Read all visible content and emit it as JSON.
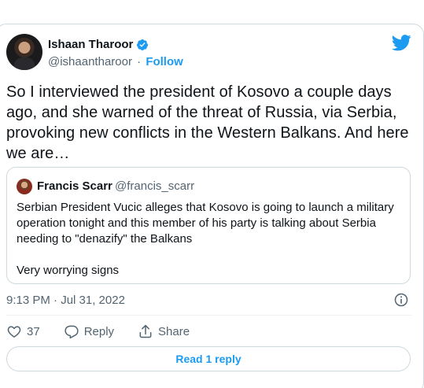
{
  "author": {
    "name": "Ishaan Tharoor",
    "handle": "@ishaantharoor",
    "separator": "·",
    "follow_label": "Follow"
  },
  "tweet": {
    "text": "So I interviewed the president of Kosovo a couple days ago, and she warned of the threat of Russia, via Serbia, provoking new conflicts in the Western Balkans. And here we are…",
    "timestamp": "9:13 PM · Jul 31, 2022"
  },
  "quoted": {
    "name": "Francis Scarr",
    "handle": "@francis_scarr",
    "text_1": "Serbian President Vucic alleges that Kosovo is going to launch a military operation tonight and this member of his party is talking about Serbia needing to \"denazify\" the Balkans",
    "text_2": "Very worrying signs"
  },
  "actions": {
    "like_count": "37",
    "reply_label": "Reply",
    "share_label": "Share"
  },
  "read_replies_label": "Read 1 reply",
  "colors": {
    "accent": "#1d9bf0",
    "text": "#0f1419",
    "muted": "#536471",
    "border": "#cfd9de"
  },
  "icons": [
    "verified-badge-icon",
    "twitter-bird-icon",
    "info-icon",
    "heart-icon",
    "reply-icon",
    "share-icon"
  ]
}
